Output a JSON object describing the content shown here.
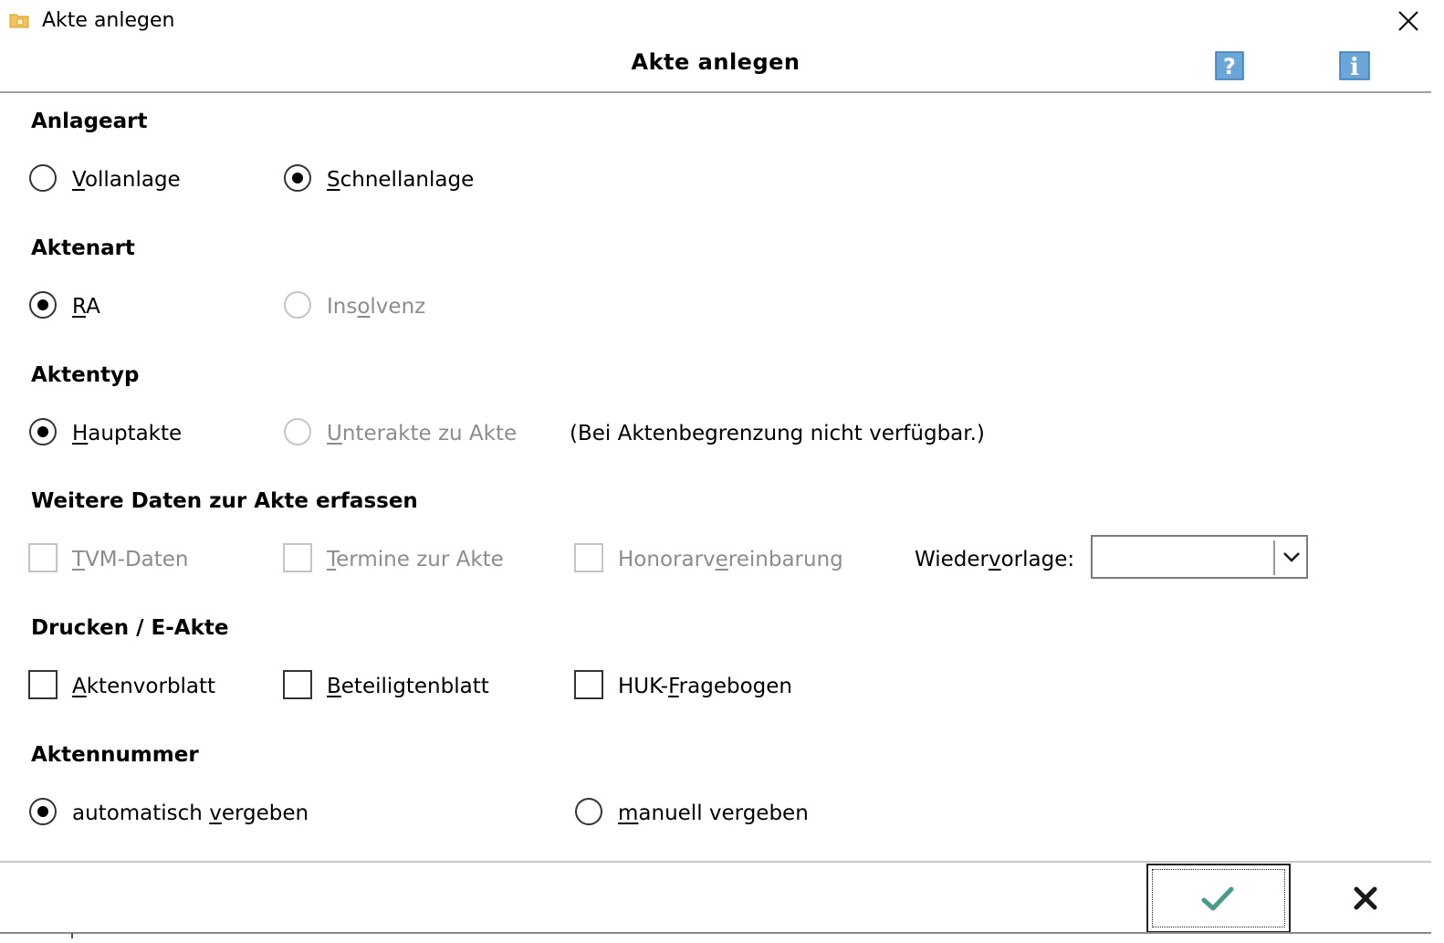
{
  "window": {
    "title": "Akte anlegen",
    "header_title": "Akte anlegen",
    "help_glyph": "?",
    "info_glyph": "i"
  },
  "sections": {
    "anlageart": {
      "heading": "Anlageart",
      "options": [
        {
          "pre": "",
          "key": "V",
          "post": "ollanlage",
          "checked": false,
          "disabled": false
        },
        {
          "pre": "",
          "key": "S",
          "post": "chnellanlage",
          "checked": true,
          "disabled": false
        }
      ]
    },
    "aktenart": {
      "heading": "Aktenart",
      "options": [
        {
          "pre": "",
          "key": "R",
          "post": "A",
          "checked": true,
          "disabled": false
        },
        {
          "pre": "Ins",
          "key": "o",
          "post": "lvenz",
          "checked": false,
          "disabled": true
        }
      ]
    },
    "aktentyp": {
      "heading": "Aktentyp",
      "options": [
        {
          "pre": "",
          "key": "H",
          "post": "auptakte",
          "checked": true,
          "disabled": false
        },
        {
          "pre": "",
          "key": "U",
          "post": "nterakte zu Akte",
          "checked": false,
          "disabled": true
        }
      ],
      "note": "(Bei Aktenbegrenzung nicht verfügbar.)"
    },
    "weitere_daten": {
      "heading": "Weitere Daten zur Akte erfassen",
      "checkboxes": [
        {
          "pre": "",
          "key": "T",
          "post": "VM-Daten",
          "checked": false,
          "disabled": true
        },
        {
          "pre": "",
          "key": "T",
          "post": "ermine zur Akte",
          "checked": false,
          "disabled": true
        },
        {
          "pre": "Honorarv",
          "key": "e",
          "post": "reinbarung",
          "checked": false,
          "disabled": true
        }
      ],
      "wiedervorlage": {
        "pre": "Wieder",
        "key": "v",
        "post": "orlage:",
        "value": ""
      }
    },
    "drucken": {
      "heading": "Drucken / E-Akte",
      "checkboxes": [
        {
          "pre": "",
          "key": "A",
          "post": "ktenvorblatt",
          "checked": false,
          "disabled": false
        },
        {
          "pre": "",
          "key": "B",
          "post": "eteiligtenblatt",
          "checked": false,
          "disabled": false
        },
        {
          "pre": "HUK-",
          "key": "F",
          "post": "ragebogen",
          "checked": false,
          "disabled": false
        }
      ]
    },
    "aktennummer": {
      "heading": "Aktennummer",
      "options": [
        {
          "pre": "automatisch ",
          "key": "v",
          "post": "ergeben",
          "checked": true,
          "disabled": false
        },
        {
          "pre": "",
          "key": "m",
          "post": "anuell vergeben",
          "checked": false,
          "disabled": false
        }
      ]
    }
  },
  "footer": {
    "ok_icon": "checkmark-icon",
    "cancel_icon": "cross-icon"
  },
  "colors": {
    "help_icon_bg": "#6aa7d8",
    "ok_check": "#4a9a8a",
    "disabled_text": "#8c8c8c"
  }
}
